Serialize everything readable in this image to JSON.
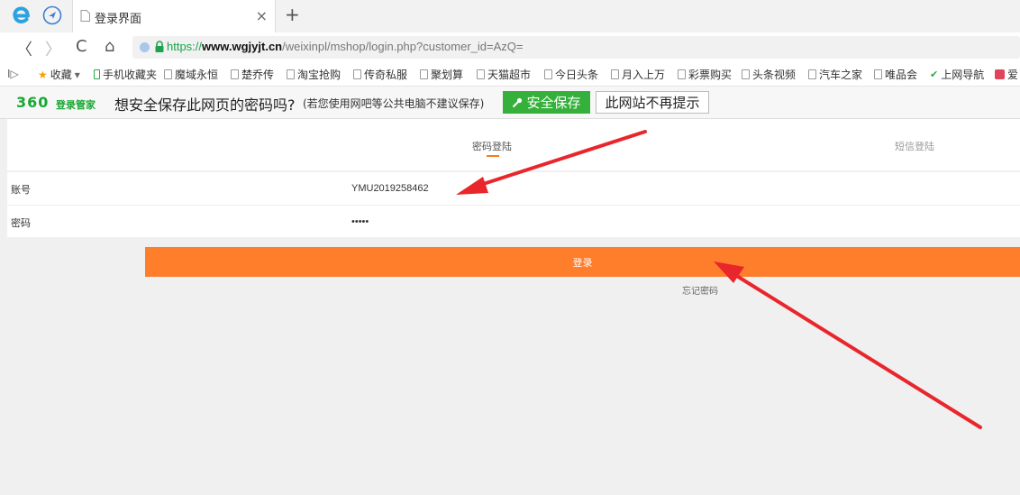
{
  "browser": {
    "tab": {
      "title": "登录界面",
      "close": "×"
    },
    "new_tab": "+",
    "url": {
      "scheme": "https://",
      "host": "www.wgjyjt.cn",
      "path": "/weixinpl/mshop/login.php?customer_id=AzQ="
    },
    "nav": {
      "back": "〈",
      "forward": "〉",
      "reload": "C",
      "home": "⌂"
    },
    "bookmarks": {
      "sidebar_toggle": "I▷",
      "items": [
        {
          "label": "收藏",
          "icon": "star-icon"
        },
        {
          "label": "手机收藏夹",
          "icon": "phone-icon"
        },
        {
          "label": "魔域永恒",
          "icon": "page-icon"
        },
        {
          "label": "楚乔传",
          "icon": "page-icon"
        },
        {
          "label": "淘宝抢购",
          "icon": "page-icon"
        },
        {
          "label": "传奇私服",
          "icon": "page-icon"
        },
        {
          "label": "聚划算",
          "icon": "page-icon"
        },
        {
          "label": "天猫超市",
          "icon": "page-icon"
        },
        {
          "label": "今日头条",
          "icon": "page-icon"
        },
        {
          "label": "月入上万",
          "icon": "page-icon"
        },
        {
          "label": "彩票购买",
          "icon": "page-icon"
        },
        {
          "label": "头条视频",
          "icon": "page-icon"
        },
        {
          "label": "汽车之家",
          "icon": "page-icon"
        },
        {
          "label": "唯品会",
          "icon": "page-icon"
        },
        {
          "label": "上网导航",
          "icon": "nav-icon"
        },
        {
          "label": "爱",
          "icon": "love-icon"
        }
      ]
    },
    "password_bar": {
      "brand": "360",
      "brand_sub": "登录管家",
      "question": "想安全保存此网页的密码吗?",
      "hint": "(若您使用网吧等公共电脑不建议保存)",
      "save_label": "安全保存",
      "never_label": "此网站不再提示"
    }
  },
  "login": {
    "tab_password": "密码登陆",
    "tab_sms": "短信登陆",
    "account_label": "账号",
    "account_value": "YMU2019258462",
    "password_label": "密码",
    "password_value": "•••••",
    "submit_label": "登录",
    "forgot_label": "忘记密码"
  },
  "colors": {
    "accent_orange": "#fe7e2c",
    "save_green": "#35b03b",
    "brand_green": "#17a832",
    "arrow_red": "#e8262b"
  }
}
